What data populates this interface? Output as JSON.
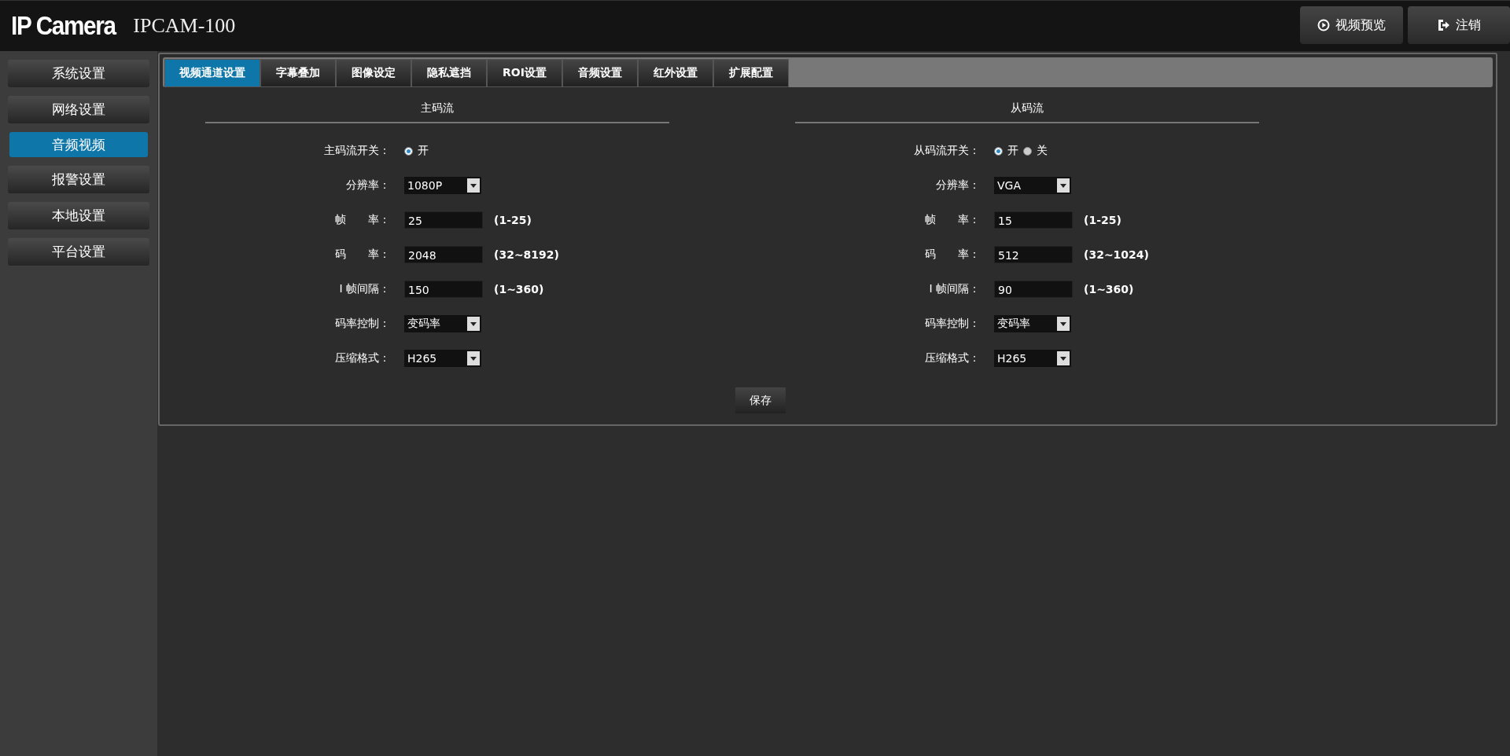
{
  "header": {
    "logo": "IP Camera",
    "model": "IPCAM-100",
    "buttons": [
      {
        "kind": "preview",
        "label": "视频预览"
      },
      {
        "kind": "logout",
        "label": "注销"
      }
    ]
  },
  "sidebar": {
    "items": [
      {
        "label": "系统设置",
        "selected": false
      },
      {
        "label": "网络设置",
        "selected": false
      },
      {
        "label": "音频视频",
        "selected": true
      },
      {
        "label": "报警设置",
        "selected": false
      },
      {
        "label": "本地设置",
        "selected": false
      },
      {
        "label": "平台设置",
        "selected": false
      }
    ]
  },
  "tabs": [
    {
      "label": "视频通道设置",
      "selected": true
    },
    {
      "label": "字幕叠加",
      "selected": false
    },
    {
      "label": "图像设定",
      "selected": false
    },
    {
      "label": "隐私遮挡",
      "selected": false
    },
    {
      "label": "ROI设置",
      "selected": false
    },
    {
      "label": "音频设置",
      "selected": false
    },
    {
      "label": "红外设置",
      "selected": false
    },
    {
      "label": "扩展配置",
      "selected": false
    }
  ],
  "streams": [
    {
      "title": "主码流",
      "rows": [
        {
          "kind": "radio",
          "label": "主码流开关：",
          "options": [
            {
              "label": "开",
              "selected": true
            }
          ]
        },
        {
          "kind": "select",
          "label": "分辨率：",
          "value": "1080P"
        },
        {
          "kind": "input",
          "label": "帧　　率：",
          "value": "25",
          "range": "(1-25)"
        },
        {
          "kind": "input",
          "label": "码　　率：",
          "value": "2048",
          "range": "(32~8192)"
        },
        {
          "kind": "input",
          "label": "I 帧间隔：",
          "value": "150",
          "range": "(1~360)"
        },
        {
          "kind": "select",
          "label": "码率控制：",
          "value": "变码率"
        },
        {
          "kind": "select",
          "label": "压缩格式：",
          "value": "H265"
        }
      ]
    },
    {
      "title": "从码流",
      "rows": [
        {
          "kind": "radio",
          "label": "从码流开关：",
          "options": [
            {
              "label": "开",
              "selected": true
            },
            {
              "label": "关",
              "selected": false
            }
          ]
        },
        {
          "kind": "select",
          "label": "分辨率：",
          "value": "VGA"
        },
        {
          "kind": "input",
          "label": "帧　　率：",
          "value": "15",
          "range": "(1-25)"
        },
        {
          "kind": "input",
          "label": "码　　率：",
          "value": "512",
          "range": "(32~1024)"
        },
        {
          "kind": "input",
          "label": "I 帧间隔：",
          "value": "90",
          "range": "(1~360)"
        },
        {
          "kind": "select",
          "label": "码率控制：",
          "value": "变码率"
        },
        {
          "kind": "select",
          "label": "压缩格式：",
          "value": "H265"
        }
      ]
    }
  ],
  "save_button": "保存"
}
